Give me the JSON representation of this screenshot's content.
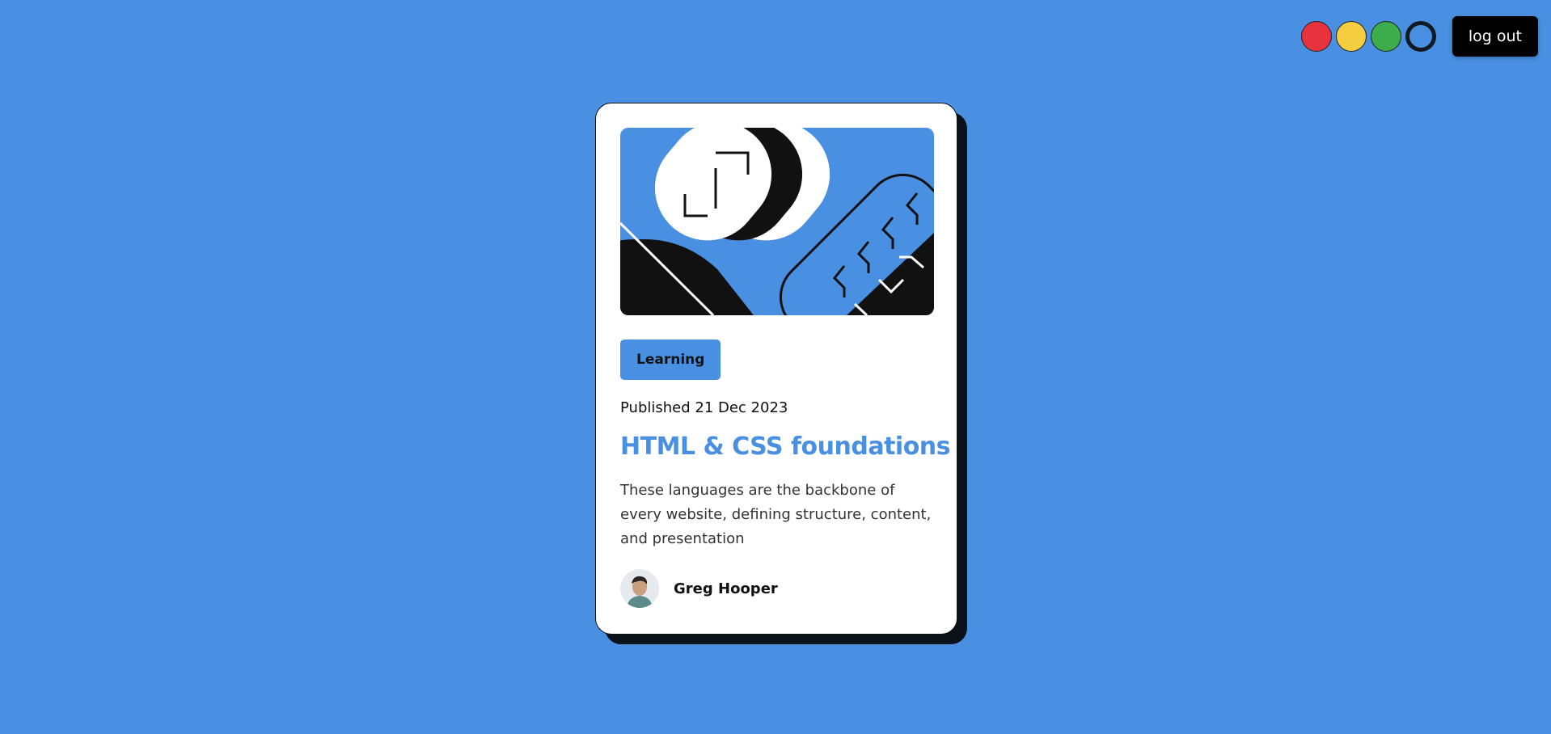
{
  "colors": {
    "background": "#4a90e2",
    "card": "#ffffff",
    "accent": "#4a90e2",
    "shadow": "#0b1219"
  },
  "theme_switcher": {
    "options": [
      {
        "name": "red",
        "color": "#e8333f"
      },
      {
        "name": "yellow",
        "color": "#f4cd41"
      },
      {
        "name": "green",
        "color": "#3bad4a"
      },
      {
        "name": "blue",
        "color": "#4a90e2",
        "selected": true
      }
    ]
  },
  "header": {
    "logout_label": "log out"
  },
  "card": {
    "tag": "Learning",
    "published": "Published 21 Dec 2023",
    "title": "HTML & CSS foundations",
    "description": "These languages are the backbone of every website, defining structure, content, and presentation",
    "author": {
      "name": "Greg Hooper"
    }
  }
}
